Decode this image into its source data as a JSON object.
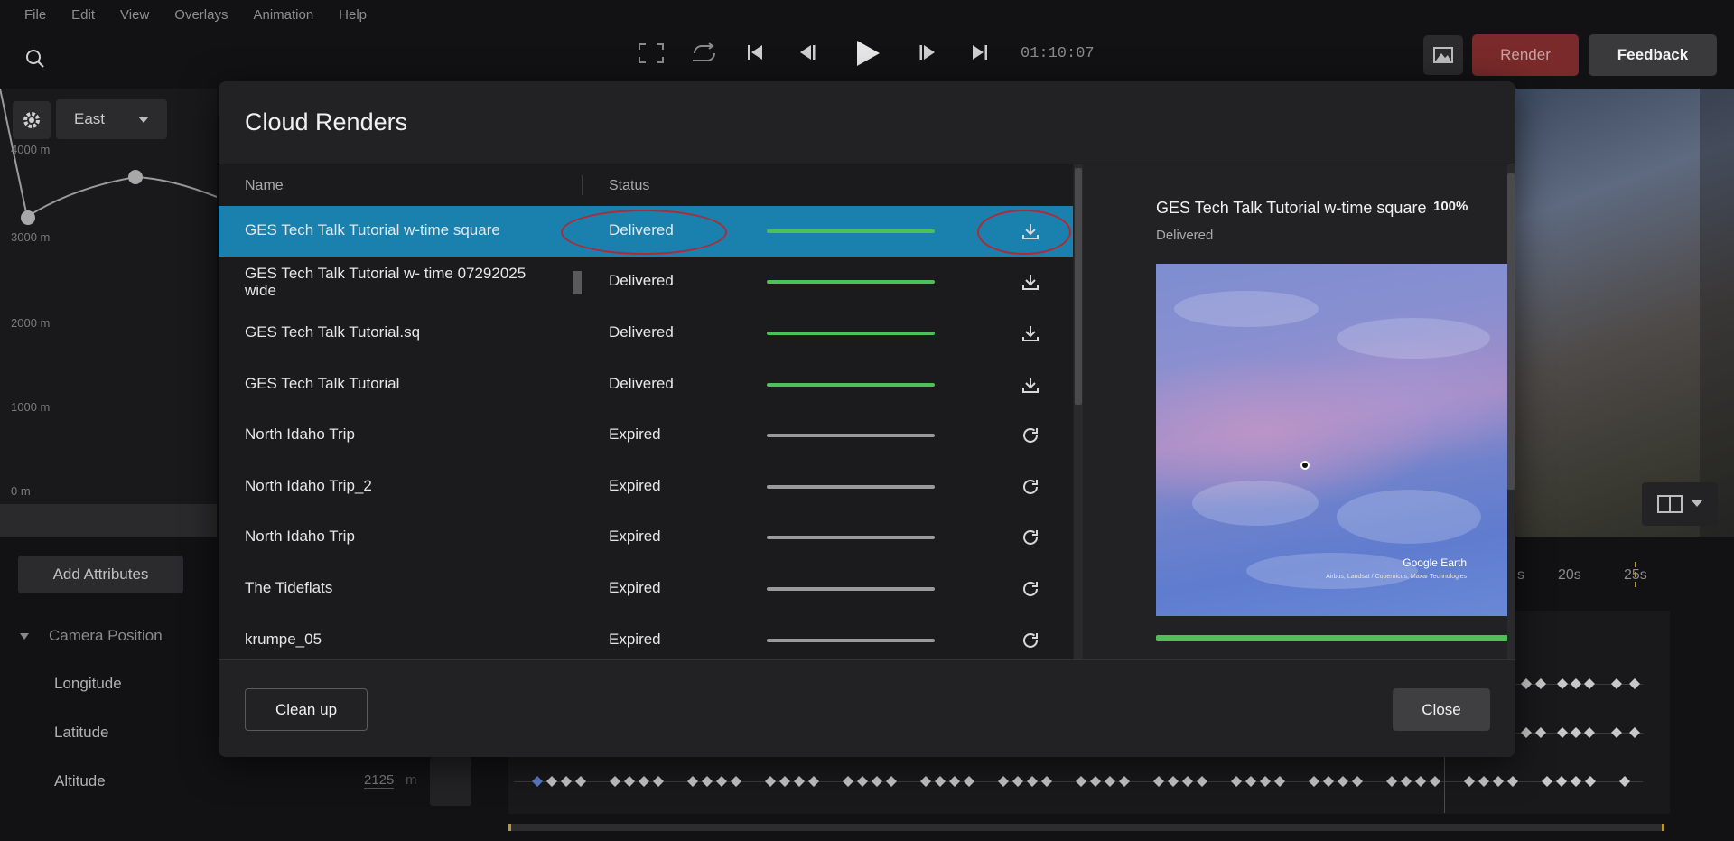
{
  "menu": [
    "File",
    "Edit",
    "View",
    "Overlays",
    "Animation",
    "Help"
  ],
  "toolbar": {
    "timecode": "01:10:07",
    "render_label": "Render",
    "feedback_label": "Feedback",
    "icons": [
      "search-icon",
      "fullscreen-icon",
      "loop-icon",
      "skip-start-icon",
      "step-back-icon",
      "play-icon",
      "step-forward-icon",
      "skip-end-icon",
      "image-icon"
    ]
  },
  "graph": {
    "direction": "East",
    "y_labels": [
      "4000 m",
      "3000 m",
      "2000 m",
      "1000 m",
      "0 m"
    ]
  },
  "attributes": {
    "add_label": "Add Attributes",
    "group": "Camera Position",
    "items": [
      "Longitude",
      "Latitude",
      "Altitude"
    ],
    "altitude_value": "2125",
    "altitude_unit": "m"
  },
  "timeline": {
    "labels": [
      "s",
      "20s",
      "25s"
    ]
  },
  "modal": {
    "title": "Cloud Renders",
    "columns": {
      "name": "Name",
      "status": "Status"
    },
    "rows": [
      {
        "name": "GES Tech Talk Tutorial w-time square",
        "status": "Delivered",
        "state": "delivered",
        "action": "download-icon"
      },
      {
        "name": "GES Tech Talk Tutorial w- time 07292025 wide",
        "status": "Delivered",
        "state": "delivered",
        "action": "download-icon"
      },
      {
        "name": "GES Tech Talk Tutorial.sq",
        "status": "Delivered",
        "state": "delivered",
        "action": "download-icon"
      },
      {
        "name": "GES Tech Talk Tutorial",
        "status": "Delivered",
        "state": "delivered",
        "action": "download-icon"
      },
      {
        "name": "North Idaho Trip",
        "status": "Expired",
        "state": "expired",
        "action": "retry-icon"
      },
      {
        "name": "North Idaho Trip_2",
        "status": "Expired",
        "state": "expired",
        "action": "retry-icon"
      },
      {
        "name": "North Idaho Trip",
        "status": "Expired",
        "state": "expired",
        "action": "retry-icon"
      },
      {
        "name": "The Tideflats",
        "status": "Expired",
        "state": "expired",
        "action": "retry-icon"
      },
      {
        "name": "krumpe_05",
        "status": "Expired",
        "state": "expired",
        "action": "retry-icon"
      }
    ],
    "preview": {
      "title": "GES Tech Talk Tutorial w-time square",
      "percent": "100%",
      "status": "Delivered",
      "progress": 1.0,
      "watermark": "Google Earth",
      "attribution": "Airbus, Landsat / Copernicus, Maxar Technologies"
    },
    "cleanup_label": "Clean up",
    "close_label": "Close"
  },
  "colors": {
    "accent_selected": "#1a80ad",
    "delivered": "#4fbf59",
    "expired": "#9a9a9a",
    "render": "#7a2a2b",
    "highlight_ellipse": "#b12a33"
  }
}
